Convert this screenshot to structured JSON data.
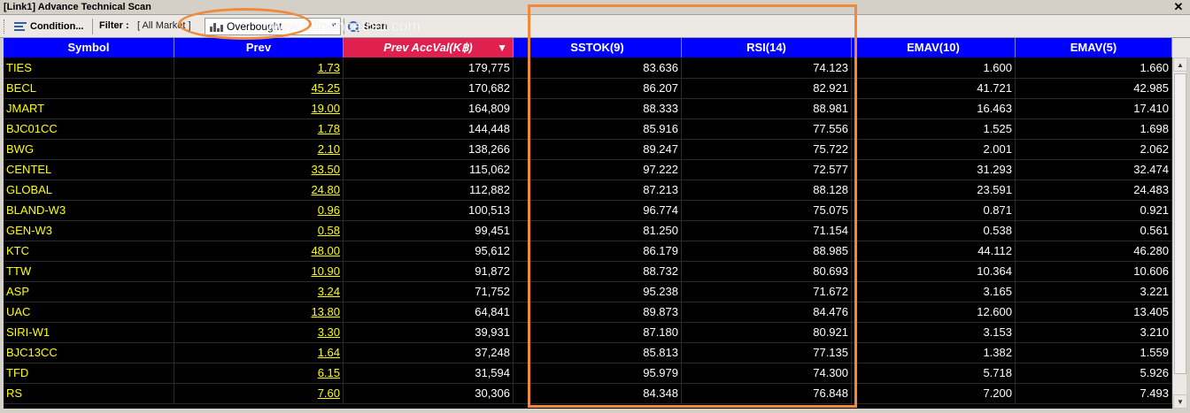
{
  "window": {
    "title": "[Link1] Advance Technical Scan",
    "close_glyph": "✕"
  },
  "toolbar": {
    "condition_label": "Condition...",
    "filter_label": "Filter :",
    "filter_value": "[ All Market ]",
    "preset_selected": "Overbought",
    "scan_label": "Scan"
  },
  "watermark": "www.efinancethai.com",
  "annotation_color": "#f0893a",
  "columns": [
    "Symbol",
    "Prev",
    "Prev AccVal(K฿)",
    "SSTOK(9)",
    "RSI(14)",
    "EMAV(10)",
    "EMAV(5)"
  ],
  "sorted_column_arrow": "▼",
  "rows": [
    {
      "symbol": "TIES",
      "prev": "1.73",
      "accval": "179,775",
      "sstok": "83.636",
      "rsi": "74.123",
      "emav10": "1.600",
      "emav5": "1.660"
    },
    {
      "symbol": "BECL",
      "prev": "45.25",
      "accval": "170,682",
      "sstok": "86.207",
      "rsi": "82.921",
      "emav10": "41.721",
      "emav5": "42.985"
    },
    {
      "symbol": "JMART",
      "prev": "19.00",
      "accval": "164,809",
      "sstok": "88.333",
      "rsi": "88.981",
      "emav10": "16.463",
      "emav5": "17.410"
    },
    {
      "symbol": "BJC01CC",
      "prev": "1.78",
      "accval": "144,448",
      "sstok": "85.916",
      "rsi": "77.556",
      "emav10": "1.525",
      "emav5": "1.698"
    },
    {
      "symbol": "BWG",
      "prev": "2.10",
      "accval": "138,266",
      "sstok": "89.247",
      "rsi": "75.722",
      "emav10": "2.001",
      "emav5": "2.062"
    },
    {
      "symbol": "CENTEL",
      "prev": "33.50",
      "accval": "115,062",
      "sstok": "97.222",
      "rsi": "72.577",
      "emav10": "31.293",
      "emav5": "32.474"
    },
    {
      "symbol": "GLOBAL",
      "prev": "24.80",
      "accval": "112,882",
      "sstok": "87.213",
      "rsi": "88.128",
      "emav10": "23.591",
      "emav5": "24.483"
    },
    {
      "symbol": "BLAND-W3",
      "prev": "0.96",
      "accval": "100,513",
      "sstok": "96.774",
      "rsi": "75.075",
      "emav10": "0.871",
      "emav5": "0.921"
    },
    {
      "symbol": "GEN-W3",
      "prev": "0.58",
      "accval": "99,451",
      "sstok": "81.250",
      "rsi": "71.154",
      "emav10": "0.538",
      "emav5": "0.561"
    },
    {
      "symbol": "KTC",
      "prev": "48.00",
      "accval": "95,612",
      "sstok": "86.179",
      "rsi": "88.985",
      "emav10": "44.112",
      "emav5": "46.280"
    },
    {
      "symbol": "TTW",
      "prev": "10.90",
      "accval": "91,872",
      "sstok": "88.732",
      "rsi": "80.693",
      "emav10": "10.364",
      "emav5": "10.606"
    },
    {
      "symbol": "ASP",
      "prev": "3.24",
      "accval": "71,752",
      "sstok": "95.238",
      "rsi": "71.672",
      "emav10": "3.165",
      "emav5": "3.221"
    },
    {
      "symbol": "UAC",
      "prev": "13.80",
      "accval": "64,841",
      "sstok": "89.873",
      "rsi": "84.476",
      "emav10": "12.600",
      "emav5": "13.405"
    },
    {
      "symbol": "SIRI-W1",
      "prev": "3.30",
      "accval": "39,931",
      "sstok": "87.180",
      "rsi": "80.921",
      "emav10": "3.153",
      "emav5": "3.210"
    },
    {
      "symbol": "BJC13CC",
      "prev": "1.64",
      "accval": "37,248",
      "sstok": "85.813",
      "rsi": "77.135",
      "emav10": "1.382",
      "emav5": "1.559"
    },
    {
      "symbol": "TFD",
      "prev": "6.15",
      "accval": "31,594",
      "sstok": "95.979",
      "rsi": "74.300",
      "emav10": "5.718",
      "emav5": "5.926"
    },
    {
      "symbol": "RS",
      "prev": "7.60",
      "accval": "30,306",
      "sstok": "84.348",
      "rsi": "76.848",
      "emav10": "7.200",
      "emav5": "7.493"
    }
  ]
}
